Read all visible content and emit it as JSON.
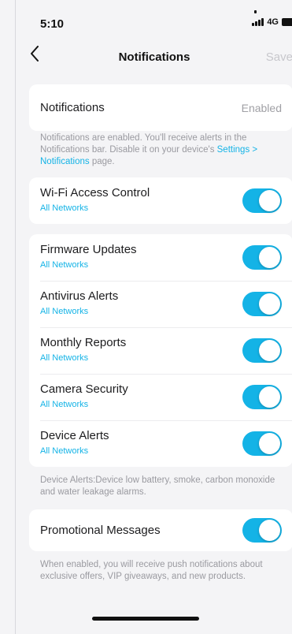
{
  "status_bar": {
    "time": "5:10",
    "network": "4G"
  },
  "nav": {
    "title": "Notifications",
    "save_label": "Save"
  },
  "notifications_row": {
    "label": "Notifications",
    "value": "Enabled"
  },
  "notifications_note": {
    "text": "Notifications are enabled. You'll receive alerts in the Notifications bar. Disable it on your device's ",
    "link": "Settings > Notifications",
    "suffix": " page."
  },
  "wifi_access": {
    "title": "Wi-Fi Access Control",
    "subtitle": "All Networks",
    "enabled": true
  },
  "alerts": [
    {
      "title": "Firmware Updates",
      "subtitle": "All Networks",
      "enabled": true
    },
    {
      "title": "Antivirus Alerts",
      "subtitle": "All Networks",
      "enabled": true
    },
    {
      "title": "Monthly Reports",
      "subtitle": "All Networks",
      "enabled": true
    },
    {
      "title": "Camera Security",
      "subtitle": "All Networks",
      "enabled": true
    },
    {
      "title": "Device Alerts",
      "subtitle": "All Networks",
      "enabled": true
    }
  ],
  "device_alerts_note": "Device Alerts:Device low battery, smoke, carbon monoxide and water leakage alarms.",
  "promotional": {
    "title": "Promotional Messages",
    "enabled": true
  },
  "promotional_note": "When enabled, you will receive push notifications about exclusive offers, VIP giveaways, and new products.",
  "colors": {
    "accent": "#14b3e6",
    "background": "#f4f4f6",
    "card": "#ffffff"
  }
}
